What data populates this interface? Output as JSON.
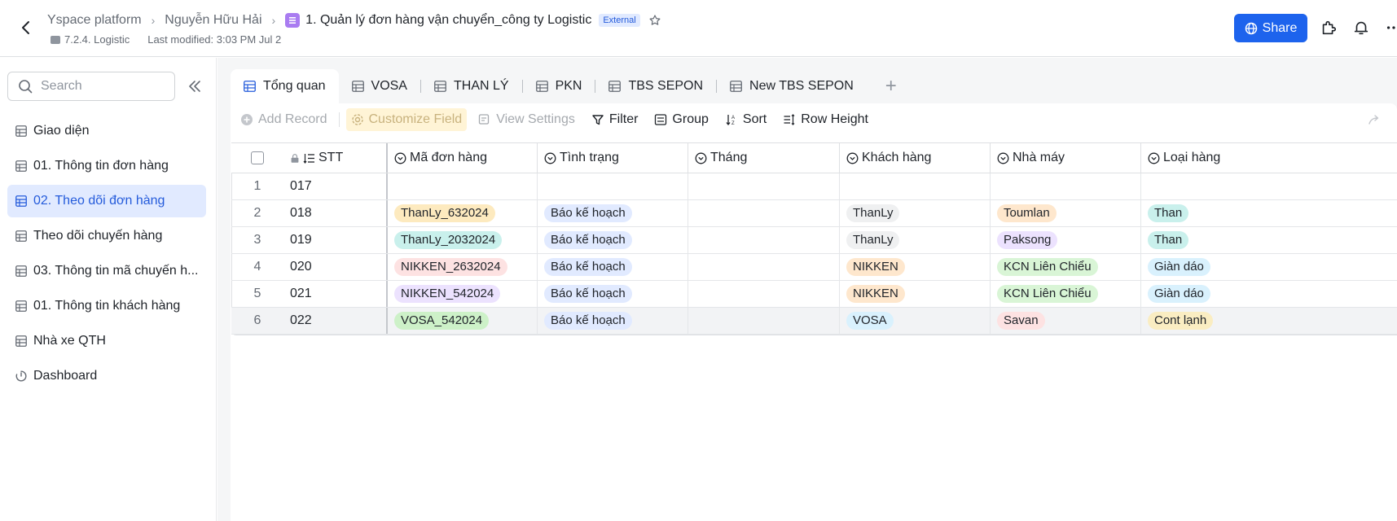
{
  "header": {
    "breadcrumbs": [
      "Yspace platform",
      "Nguyễn Hữu Hải"
    ],
    "doc_title": "1. Quản lý đơn hàng vận chuyển_công ty Logistic",
    "external_badge": "External",
    "folder": "7.2.4. Logistic",
    "last_modified": "Last modified: 3:03 PM Jul 2",
    "share_label": "Share"
  },
  "sidebar": {
    "search_placeholder": "Search",
    "items": [
      {
        "label": "Giao diện",
        "icon": "table-icon"
      },
      {
        "label": "01. Thông tin đơn hàng",
        "icon": "table-icon"
      },
      {
        "label": "02. Theo dõi đơn hàng",
        "icon": "table-icon",
        "active": true
      },
      {
        "label": "Theo dõi chuyến hàng",
        "icon": "table-icon"
      },
      {
        "label": "03. Thông tin mã chuyến h...",
        "icon": "table-icon"
      },
      {
        "label": "01. Thông tin khách hàng",
        "icon": "table-icon"
      },
      {
        "label": "Nhà xe QTH",
        "icon": "table-icon"
      },
      {
        "label": "Dashboard",
        "icon": "dashboard-icon"
      }
    ]
  },
  "tabs": [
    "Tổng quan",
    "VOSA",
    "THAN LÝ",
    "PKN",
    "TBS SEPON",
    "New TBS SEPON"
  ],
  "toolbar": {
    "add_record": "Add Record",
    "customize_field": "Customize Field",
    "view_settings": "View Settings",
    "filter": "Filter",
    "group": "Group",
    "sort": "Sort",
    "row_height": "Row Height"
  },
  "table": {
    "columns": [
      "STT",
      "Mã đơn hàng",
      "Tình trạng",
      "Tháng",
      "Khách hàng",
      "Nhà máy",
      "Loại hàng"
    ],
    "rows": [
      {
        "n": "1",
        "stt": "017",
        "ma": "",
        "tt": "",
        "thang": "",
        "kh": "",
        "nm": "",
        "lh": ""
      },
      {
        "n": "2",
        "stt": "018",
        "ma": "ThanLy_632024",
        "tt": "Báo kế hoạch",
        "thang": "",
        "kh": "ThanLy",
        "nm": "Toumlan",
        "lh": "Than"
      },
      {
        "n": "3",
        "stt": "019",
        "ma": "ThanLy_2032024",
        "tt": "Báo kế hoạch",
        "thang": "",
        "kh": "ThanLy",
        "nm": "Paksong",
        "lh": "Than"
      },
      {
        "n": "4",
        "stt": "020",
        "ma": "NIKKEN_2632024",
        "tt": "Báo kế hoạch",
        "thang": "",
        "kh": "NIKKEN",
        "nm": "KCN Liên Chiểu",
        "lh": "Giàn dáo"
      },
      {
        "n": "5",
        "stt": "021",
        "ma": "NIKKEN_542024",
        "tt": "Báo kế hoạch",
        "thang": "",
        "kh": "NIKKEN",
        "nm": "KCN Liên Chiểu",
        "lh": "Giàn dáo"
      },
      {
        "n": "6",
        "stt": "022",
        "ma": "VOSA_542024",
        "tt": "Báo kế hoạch",
        "thang": "",
        "kh": "VOSA",
        "nm": "Savan",
        "lh": "Cont lạnh"
      }
    ],
    "pill_colors": {
      "ma": [
        "",
        "#fdeabf",
        "#c9f0ec",
        "#fde2e2",
        "#ece2fe",
        "#cdf1c8"
      ],
      "tt": "#e1eaff",
      "kh": [
        "",
        "#eff0f1",
        "#eff0f1",
        "#fee7cd",
        "#fee7cd",
        "#d9f1fd"
      ],
      "nm": [
        "",
        "#fee7cd",
        "#ece2fe",
        "#d9f5d6",
        "#d9f5d6",
        "#fde2e2"
      ],
      "lh": [
        "",
        "#c9f0ec",
        "#c9f0ec",
        "#d9f1fd",
        "#d9f1fd",
        "#faedc2"
      ]
    }
  }
}
